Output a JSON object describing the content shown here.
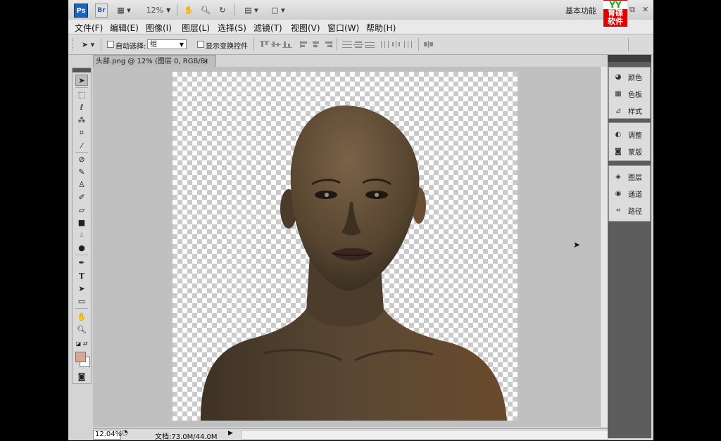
{
  "titlebar": {
    "app_logo": "Ps",
    "bridge_label": "Br",
    "zoom_value": "12%",
    "workspace": "基本功能",
    "watermark_top": "YY",
    "watermark_text": "育碟软件"
  },
  "menu": [
    "文件(F)",
    "编辑(E)",
    "图像(I)",
    "图层(L)",
    "选择(S)",
    "滤镜(T)",
    "视图(V)",
    "窗口(W)",
    "帮助(H)"
  ],
  "options": {
    "auto_select_label": "自动选择:",
    "auto_select_value": "组",
    "show_transform_label": "显示变换控件"
  },
  "document": {
    "tab_title": "头部.png @ 12% (图层 0, RGB/8)",
    "tab_close": "×"
  },
  "statusbar": {
    "zoom": "12.04%",
    "doc_info": "文档:73.0M/44.0M"
  },
  "panels": {
    "group1": [
      {
        "label": "颜色",
        "icon": "color-icon"
      },
      {
        "label": "色板",
        "icon": "swatches-icon"
      },
      {
        "label": "样式",
        "icon": "styles-icon"
      }
    ],
    "group2": [
      {
        "label": "调整",
        "icon": "adjustments-icon"
      },
      {
        "label": "蒙版",
        "icon": "masks-icon"
      }
    ],
    "group3": [
      {
        "label": "图层",
        "icon": "layers-icon"
      },
      {
        "label": "通道",
        "icon": "channels-icon"
      },
      {
        "label": "路径",
        "icon": "paths-icon"
      }
    ]
  },
  "colors": {
    "foreground": "#d9a88f",
    "background": "#ffffff",
    "skin": "#5a4630"
  }
}
